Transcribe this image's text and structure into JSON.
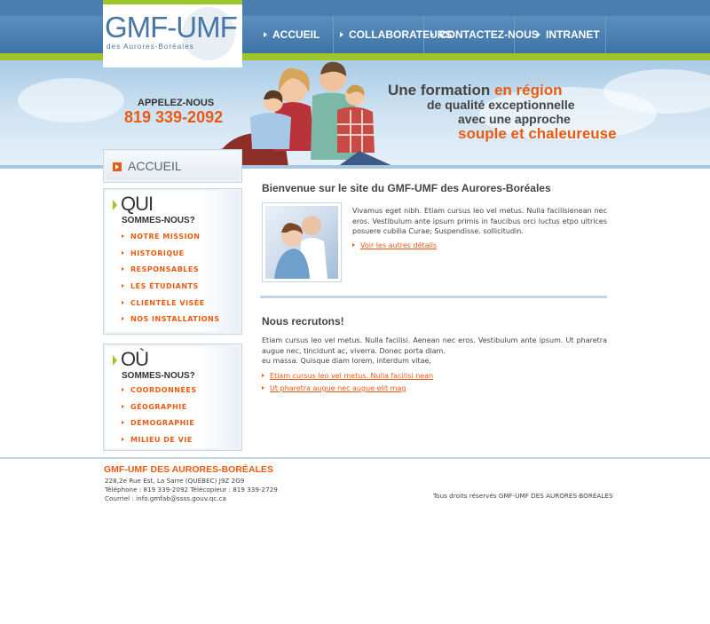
{
  "logo": {
    "text": "GMF-UMF",
    "subtitle": "des Aurores-Boréales"
  },
  "nav": {
    "items": [
      {
        "label": "ACCUEIL"
      },
      {
        "label": "COLLABORATEURS"
      },
      {
        "label": "CONTACTEZ-NOUS"
      },
      {
        "label": "INTRANET"
      }
    ]
  },
  "hero": {
    "call_label": "APPELEZ-NOUS",
    "phone": "819 339-2092",
    "slogan_line1_a": "Une formation ",
    "slogan_line1_b": "en région",
    "slogan_line2": "de qualité exceptionnelle",
    "slogan_line3": "avec une approche",
    "slogan_line4": "souple et chaleureuse"
  },
  "sidebar": {
    "home_label": "ACCUEIL",
    "qui": {
      "title": "QUI",
      "subtitle": "SOMMES-NOUS?",
      "items": [
        "NOTRE MISSION",
        "HISTORIQUE",
        "RESPONSABLES",
        "LES ÉTUDIANTS",
        "CLIENTÈLE VISÉE",
        "NOS INSTALLATIONS"
      ]
    },
    "ou": {
      "title": "OÙ",
      "subtitle": "SOMMES-NOUS?",
      "items": [
        "COORDONNÉES",
        "GÉOGRAPHIE",
        "DÉMOGRAPHIE",
        "MILIEU DE VIE"
      ]
    }
  },
  "main": {
    "welcome_title": "Bienvenue sur le site du GMF-UMF des Aurores-Boréales",
    "welcome_text": "Vivamus eget nibh. Etiam cursus leo vel metus. Nulla facilisienean nec eros. Vestibulum ante ipsum primis in faucibus orci luctus etpo ultrices posuere cubilia Curae; Suspendisse. sollicitudin.",
    "more_link": "Voir les autres détails",
    "recruit_title": "Nous recrutons!",
    "recruit_text_1": "Etiam cursus leo vel metus. Nulla facilisi. Aenean nec eros. Vestibulum ante ipsum. Ut pharetra augue nec, tincidunt ac, viverra. Donec porta diam.",
    "recruit_text_2": "eu massa. Quisque diam lorem, interdum vitae,",
    "link_1": "Etiam cursus leo vel metus. Nulla facilisi nean",
    "link_2": "Ut pharetra augue nec augue elit mag"
  },
  "footer": {
    "title": "GMF-UMF DES AURORES-BORÉALES",
    "address": "228,2e Rue Est, La Sarre (QUÉBEC) J9Z 2G9",
    "phones": "Téléphone : 819 339-2092  Télécopieur : 819 339-2729",
    "email": "Courriel : info.gmfab@ssss.gouv.qc.ca",
    "copyright": "Tous droits réservés GMF-UMF DES AURORES-BORÉALES"
  },
  "colors": {
    "accent": "#ea5a12",
    "brand_blue": "#4877a7",
    "green": "#9cc629"
  }
}
